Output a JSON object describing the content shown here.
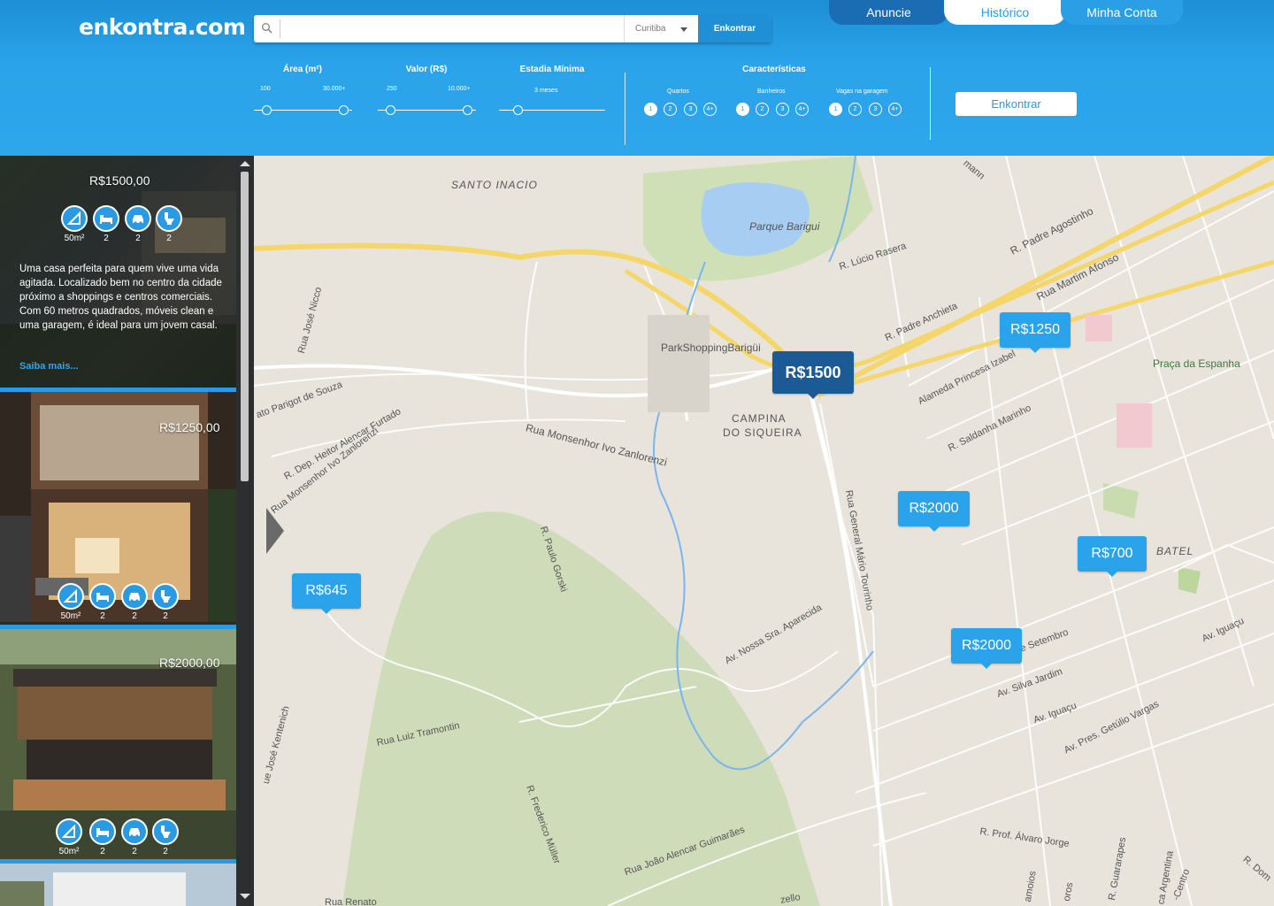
{
  "header": {
    "logo": "enkontra.com",
    "search": {
      "placeholder": "",
      "city": "Curitiba",
      "button": "Enkontrar"
    },
    "tabs": [
      "Anuncie",
      "Histórico",
      "Minha Conta"
    ],
    "active_tab": "Histórico"
  },
  "filters": {
    "area": {
      "label": "Área (m²)",
      "min": "100",
      "max": "30.000+"
    },
    "valor": {
      "label": "Valor (R$)",
      "min": "250",
      "max": "10.000+"
    },
    "estadia": {
      "label": "Estadia Mínima",
      "value": "3 meses"
    },
    "caracteristicas": {
      "label": "Características",
      "groups": [
        {
          "label": "Quartos",
          "options": [
            "1",
            "2",
            "3",
            "4+"
          ],
          "selected": "1"
        },
        {
          "label": "Banheiros",
          "options": [
            "1",
            "2",
            "3",
            "4+"
          ],
          "selected": "1"
        },
        {
          "label": "Vagas na garagem",
          "options": [
            "1",
            "2",
            "3",
            "4+"
          ],
          "selected": "1"
        }
      ]
    },
    "button": "Enkontrar"
  },
  "listings": [
    {
      "price": "R$1500,00",
      "area": "50m²",
      "bedrooms": "2",
      "garage": "2",
      "bathrooms": "2",
      "description": "Uma casa perfeita para quem vive uma vida agitada. Localizado bem no centro da cidade próximo a shoppings e centros comerciais. Com 60 metros quadrados, móveis clean e uma garagem, é ideal para um jovem casal.",
      "more": "Saiba mais..."
    },
    {
      "price": "R$1250,00",
      "area": "50m²",
      "bedrooms": "2",
      "garage": "2",
      "bathrooms": "2"
    },
    {
      "price": "R$2000,00",
      "area": "50m²",
      "bedrooms": "2",
      "garage": "2",
      "bathrooms": "2"
    }
  ],
  "map": {
    "pins": [
      "R$1500",
      "R$1250",
      "R$2000",
      "R$700",
      "R$2000",
      "R$645"
    ],
    "selected_pin": "R$1500",
    "labels": {
      "santo_inacio": "SANTO INACIO",
      "parque": "Parque Barigui",
      "shopping": "ParkShoppingBarigüi",
      "campina": "CAMPINA",
      "siqueira": "DO SIQUEIRA",
      "batel": "BATEL",
      "praca": "Praça da Espanha",
      "lucio": "R. Lúcio Rasera",
      "agostinho": "R. Padre Agostinho",
      "martim": "Rua Martim Afonso",
      "anchieta": "R. Padre Anchieta",
      "izabel": "Alameda Princesa Izabel",
      "marinho": "R. Saldanha Marinho",
      "nicco": "Rua José Nicco",
      "parigot": "ato Parigot de Souza",
      "furtado": "R. Dep. Heitor Alencar Furtado",
      "zanlorenzi": "Rua Monsenhor Ivo Zanlorenzi",
      "zanlorenzi2": "Rua Monsenhor Ivo Zanlorenzi",
      "gorski": "R. Paulo Gorski",
      "tourinho": "Rua General Mário Tourinho",
      "aparecida": "Av. Nossa Sra. Aparecida",
      "tramontin": "Rua Luiz Tramontin",
      "kentenich": "ue José Kentenich",
      "muller": "R. Frederico Müller",
      "guimaraes": "Rua João Alencar Guimarães",
      "setembro": "e Setembro",
      "jardim": "Av. Silva Jardim",
      "iguacu": "Av. Iguaçu",
      "iguacu2": "Av. Iguaçu",
      "getulio": "Av. Pres. Getúlio Vargas",
      "alvaro": "R. Prof. Álvaro Jorge",
      "guararapes": "R. Guararapes",
      "argentina": "ca Argentina",
      "centro": "-Centro",
      "dom": "R. Dom",
      "amoios": "amoios",
      "orods": "oros",
      "renato": "Rua Renato",
      "zello": "zello",
      "mann": "mann"
    }
  },
  "colors": {
    "header": "#2aa3ea",
    "accent": "#2a9be3",
    "selected_pin": "#1c5a96",
    "sidebar": "#2a2c2e"
  }
}
